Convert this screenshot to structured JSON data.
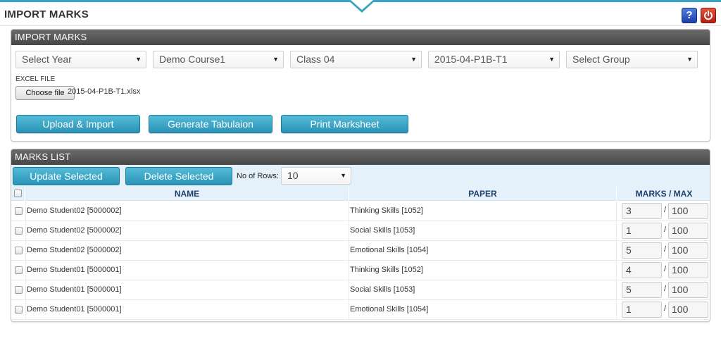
{
  "page": {
    "title": "IMPORT MARKS",
    "help_label": "?"
  },
  "import_panel": {
    "header": "IMPORT MARKS",
    "selects": [
      {
        "value": "Select Year"
      },
      {
        "value": "Demo Course1"
      },
      {
        "value": "Class 04"
      },
      {
        "value": "2015-04-P1B-T1"
      },
      {
        "value": "Select Group"
      }
    ],
    "file_label": "EXCEL FILE",
    "choose_file_label": "Choose file",
    "file_name": "2015-04-P1B-T1.xlsx",
    "buttons": {
      "upload": "Upload & Import",
      "tabulation": "Generate Tabulaion",
      "print": "Print Marksheet"
    }
  },
  "marks_panel": {
    "header": "MARKS LIST",
    "update_label": "Update Selected",
    "delete_label": "Delete Selected",
    "rows_label": "No of Rows:",
    "rows_value": "10",
    "columns": {
      "name": "NAME",
      "paper": "PAPER",
      "marks": "MARKS / MAX"
    },
    "rows": [
      {
        "name": "Demo Student02 [5000002]",
        "paper": "Thinking Skills [1052]",
        "marks": "3",
        "max": "100"
      },
      {
        "name": "Demo Student02 [5000002]",
        "paper": "Social Skills [1053]",
        "marks": "1",
        "max": "100"
      },
      {
        "name": "Demo Student02 [5000002]",
        "paper": "Emotional Skills [1054]",
        "marks": "5",
        "max": "100"
      },
      {
        "name": "Demo Student01 [5000001]",
        "paper": "Thinking Skills [1052]",
        "marks": "4",
        "max": "100"
      },
      {
        "name": "Demo Student01 [5000001]",
        "paper": "Social Skills [1053]",
        "marks": "5",
        "max": "100"
      },
      {
        "name": "Demo Student01 [5000001]",
        "paper": "Emotional Skills [1054]",
        "marks": "1",
        "max": "100"
      }
    ]
  },
  "icons": {
    "help": "help-icon",
    "power": "power-icon",
    "caret": "chevron-down-icon"
  },
  "colors": {
    "accent": "#3aa3c2",
    "button": "#2a93b6",
    "panel_header": "#474747",
    "table_header": "#e4f1fb",
    "help": "#1d3fa6",
    "power": "#b31e0e"
  }
}
